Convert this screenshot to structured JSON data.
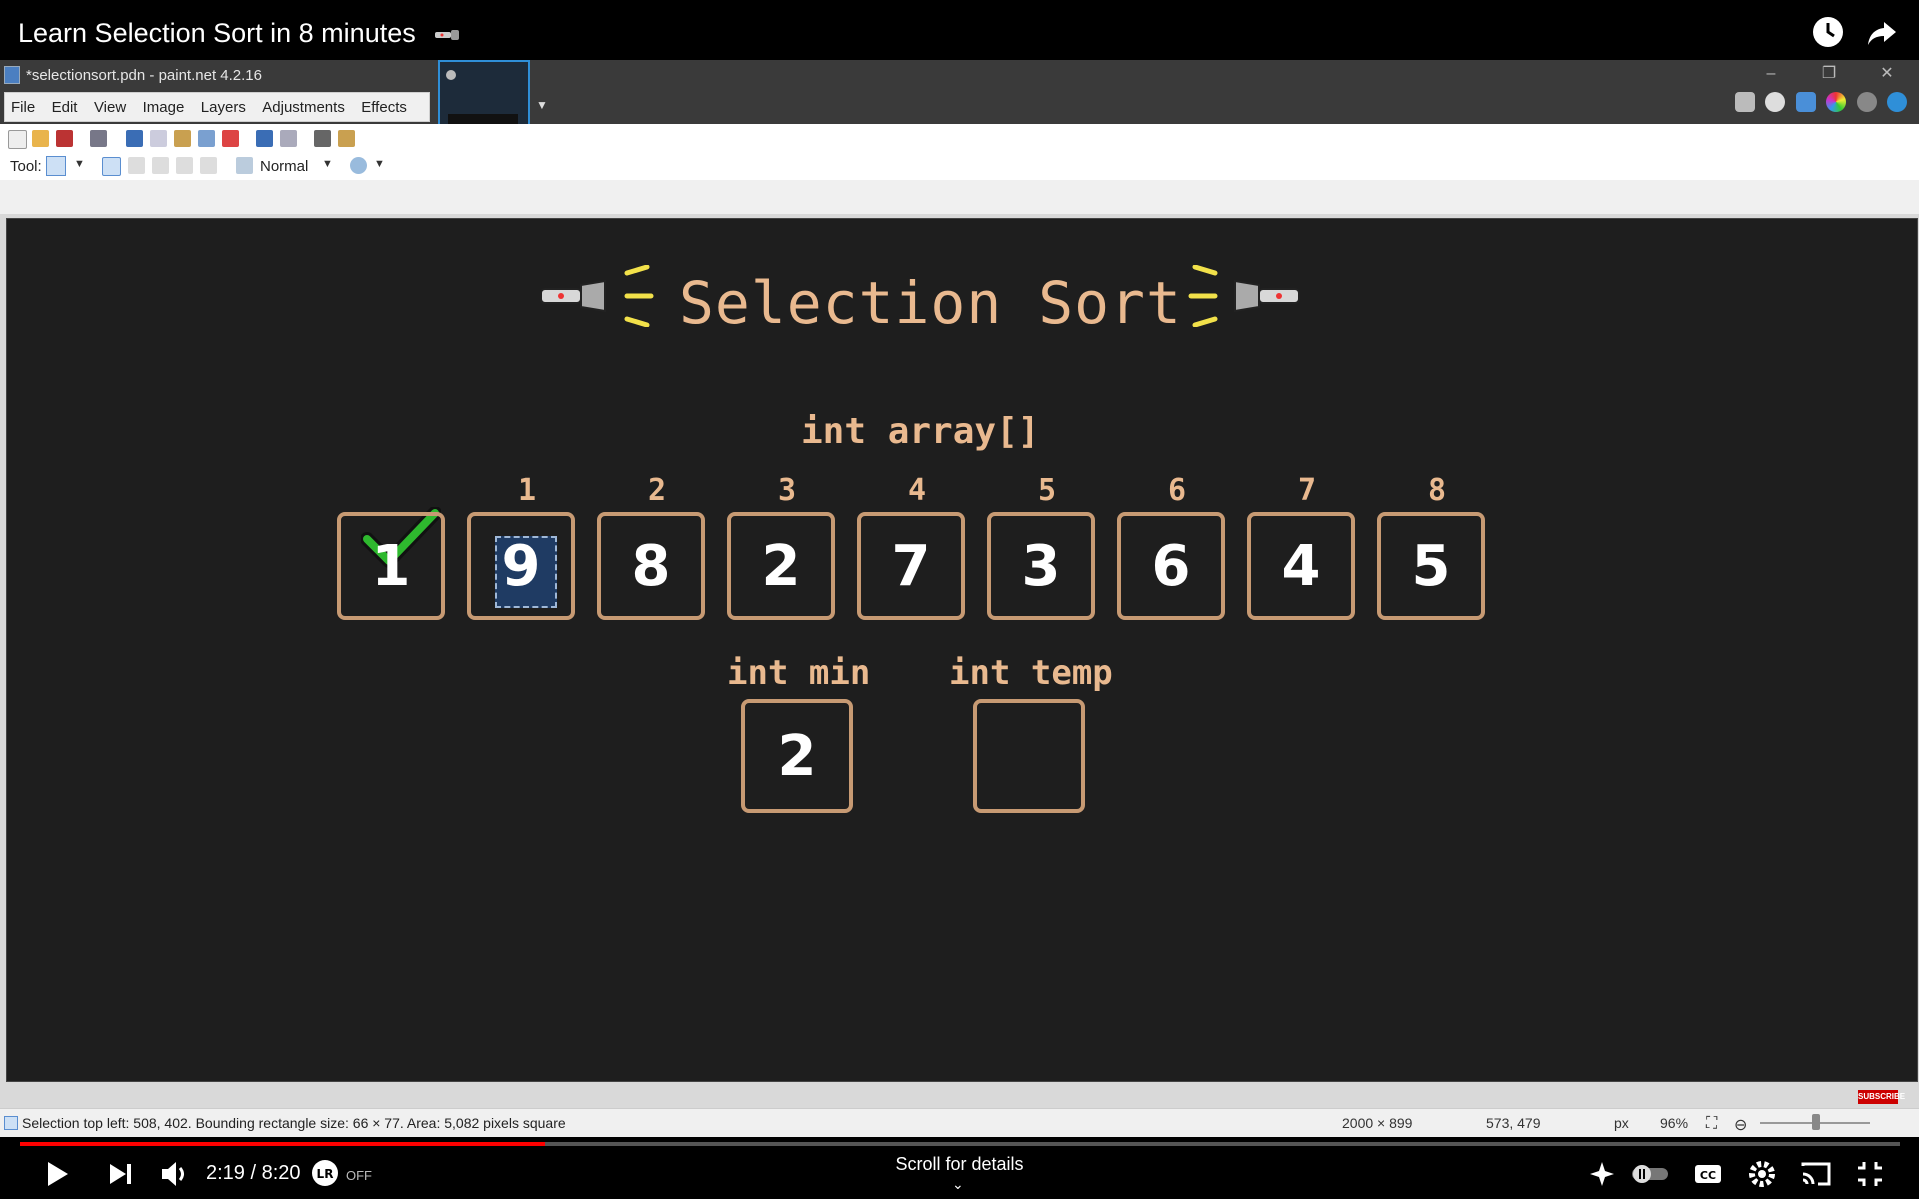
{
  "video": {
    "title": "Learn Selection Sort in 8 minutes",
    "time": "2:19 / 8:20",
    "autoplay_state": "OFF",
    "scroll_hint": "Scroll for details",
    "progress_fraction": 0.279
  },
  "paintnet": {
    "window_title": "*selectionsort.pdn - paint.net 4.2.16",
    "menu": [
      "File",
      "Edit",
      "View",
      "Image",
      "Layers",
      "Adjustments",
      "Effects"
    ],
    "tool_label": "Tool:",
    "blend_mode": "Normal",
    "status": {
      "selection_info": "Selection top left: 508, 402. Bounding rectangle size: 66 × 77. Area: 5,082 pixels square",
      "image_size": "2000 × 899",
      "cursor_pos": "573, 479",
      "units": "px",
      "zoom": "96%",
      "subscribe": "SUBSCRIBE"
    }
  },
  "slide": {
    "heading": "Selection Sort",
    "array_label": "int array[]",
    "indices": [
      "",
      "1",
      "2",
      "3",
      "4",
      "5",
      "6",
      "7",
      "8"
    ],
    "values": [
      "1",
      "9",
      "8",
      "2",
      "7",
      "3",
      "6",
      "4",
      "5"
    ],
    "min_label": "int min",
    "min_value": "2",
    "temp_label": "int temp",
    "temp_value": ""
  },
  "colors": {
    "accent_text": "#e9b98f",
    "box_border": "#c79a73",
    "checkmark": "#2eb82e",
    "canvas_bg": "#1e1e1e",
    "progress": "#ff0000"
  }
}
